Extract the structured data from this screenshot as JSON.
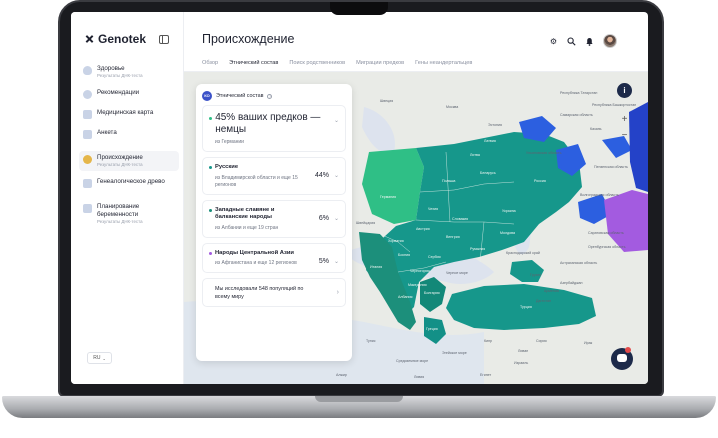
{
  "app": {
    "brand": "Genotek",
    "page_title": "Происхождение",
    "language": "RU"
  },
  "sidebar": {
    "items": [
      {
        "label": "Здоровье",
        "sub": "Результаты ДНК-теста",
        "color": "#c9d3e6"
      },
      {
        "label": "Рекомендации",
        "sub": "",
        "color": "#c9d3e6"
      },
      {
        "label": "Медицинская карта",
        "sub": "",
        "color": "#c9d3e6"
      },
      {
        "label": "Анкета",
        "sub": "",
        "color": "#c9d3e6"
      },
      {
        "label": "Происхождение",
        "sub": "Результаты ДНК-теста",
        "color": "#e5b64a"
      },
      {
        "label": "Генеалогическое древо",
        "sub": "",
        "color": "#c9d3e6"
      },
      {
        "label": "Планирование беременности",
        "sub": "Результаты ДНК-теста",
        "color": "#c9d3e6"
      }
    ]
  },
  "tabs": [
    {
      "label": "Обзор"
    },
    {
      "label": "Этнический состав"
    },
    {
      "label": "Поиск родственников"
    },
    {
      "label": "Миграции предков"
    },
    {
      "label": "Гены неандертальцев"
    }
  ],
  "panel": {
    "tag": "КО",
    "title": "Этнический состав",
    "help_icon": "?",
    "main": {
      "title": "45% ваших предков — немцы",
      "sub": "из Германии",
      "color": "#2fbf86"
    },
    "rows": [
      {
        "name": "Русские",
        "sub": "из Владимирской области и еще 15 регионов",
        "pct": "44%",
        "color": "#16978b"
      },
      {
        "name": "Западные славяне и балканские народы",
        "sub": "из Албании и еще 19 стран",
        "pct": "6%",
        "color": "#1c8f7b"
      },
      {
        "name": "Народы Центральной Азии",
        "sub": "из Афганистана и еще 12 регионов",
        "pct": "5%",
        "color": "#a35be0"
      }
    ],
    "footer": "Мы исследовали 548 популяций по всему миру"
  },
  "map": {
    "info": "i",
    "zoom_in": "+",
    "zoom_out": "−",
    "labels": {
      "germany": "Германия",
      "poland": "Польша",
      "czech": "Чехия",
      "austria": "Австрия",
      "slovakia": "Словакия",
      "hungary": "Венгрия",
      "romania": "Румыния",
      "ukraine": "Украина",
      "belarus": "Беларусь",
      "lithuania": "Литва",
      "latvia": "Латвия",
      "estonia": "Эстония",
      "moldova": "Молдова",
      "serbia": "Сербия",
      "croatia": "Хорватия",
      "bosnia": "Босния",
      "bulgaria": "Болгария",
      "greece": "Греция",
      "turkey": "Турция",
      "italy": "Италия",
      "switzerland": "Швейцария",
      "macedonia": "Македония",
      "albania": "Албания",
      "montenegro": "Черногория",
      "russia": "Россия",
      "georgia": "Грузия",
      "armenia": "Армения",
      "azerbaijan": "Азербайджан",
      "syria": "Сирия",
      "iraq": "Ирак",
      "lebanon": "Ливан",
      "israel": "Израиль",
      "cyprus": "Кипр",
      "egypt": "Египет",
      "libya": "Ливия",
      "tunisia": "Тунис",
      "algeria": "Алжир",
      "sweden": "Швеция",
      "black_sea": "Черное море",
      "mediterranean": "Средиземное море",
      "aegean": "Эгейское море",
      "tatarstan": "Республика Татарстан",
      "samara": "Самарская область",
      "saratov": "Саратовская область",
      "volgograd": "Волгоградская область",
      "orenburg": "Оренбургская область",
      "krasnodar": "Краснодарский край",
      "penza": "Пензенская область",
      "kazan": "Казань",
      "ulyanovsk": "Ульяновская область",
      "bashkortostan": "Республика Башкортостан",
      "moscow": "Москва",
      "astrakhan": "Астраханская область",
      "dagestan": "Дагестан"
    }
  }
}
